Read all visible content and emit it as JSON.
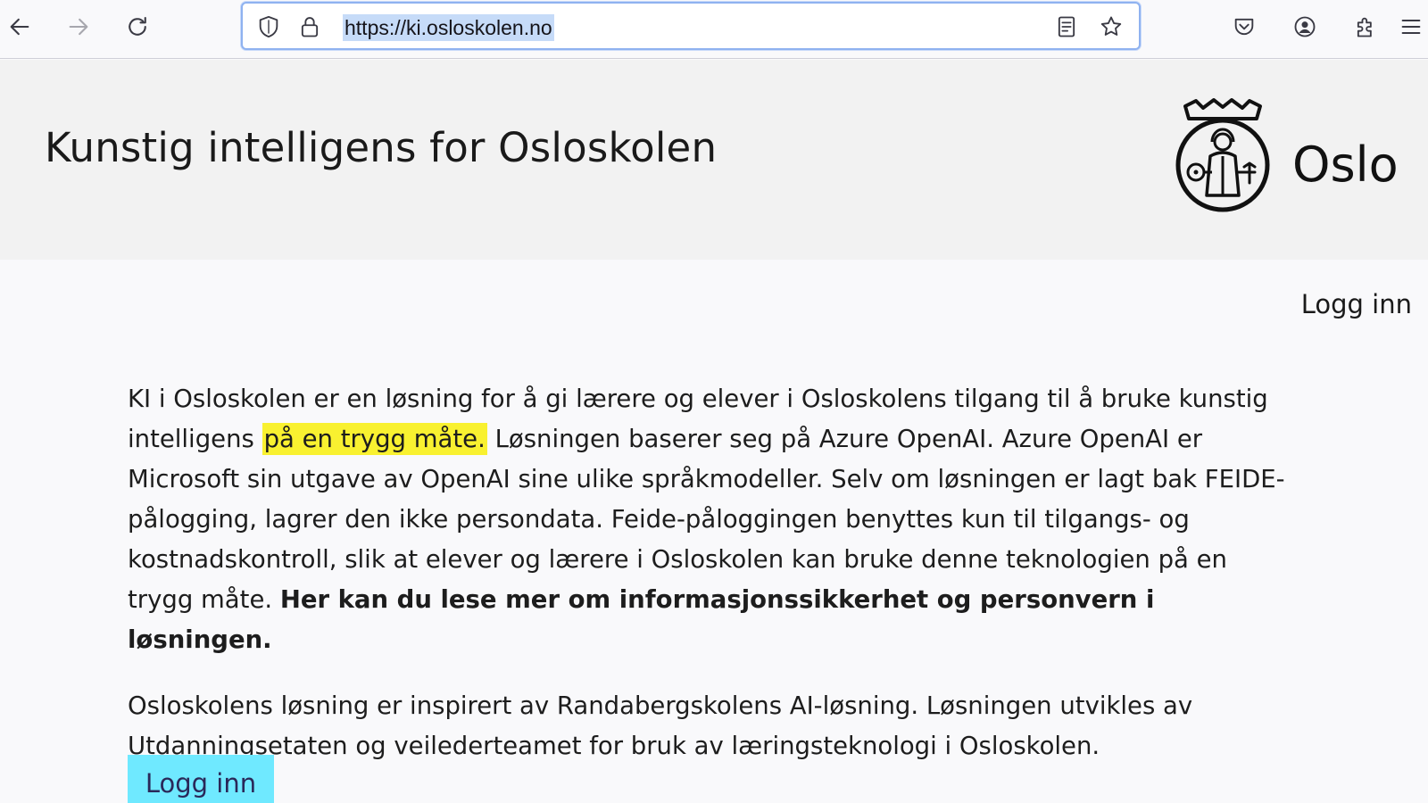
{
  "browser": {
    "url": "https://ki.osloskolen.no"
  },
  "header": {
    "title": "Kunstig intelligens for Osloskolen",
    "logo_word": "Oslo"
  },
  "nav": {
    "login_label": "Logg inn"
  },
  "main": {
    "p1_part1": "KI i Osloskolen er en løsning for å gi lærere og elever i Osloskolens tilgang til å bruke kunstig intelligens ",
    "p1_highlight": "på en trygg måte.",
    "p1_part2": " Løsningen baserer seg på Azure OpenAI. Azure OpenAI er Microsoft sin utgave av OpenAI sine ulike språkmodeller. Selv om løsningen er lagt bak FEIDE-pålogging, lagrer den ikke persondata. Feide-påloggingen benyttes kun til tilgangs- og kostnadskontroll, slik at elever og lærere i Osloskolen kan bruke denne teknologien på en trygg måte. ",
    "p1_link": "Her kan du lese mer om informasjonssikkerhet og personvern i løsningen.",
    "p2": "Osloskolens løsning er inspirert av Randabergskolens AI-løsning. Løsningen utvikles av Utdanningsetaten og veilederteamet for bruk av læringsteknologi i Osloskolen.",
    "cta_label": "Logg inn"
  },
  "colors": {
    "highlight": "#f9f130",
    "cta_background": "#6fe9ff",
    "header_background": "#f2f2f2"
  }
}
